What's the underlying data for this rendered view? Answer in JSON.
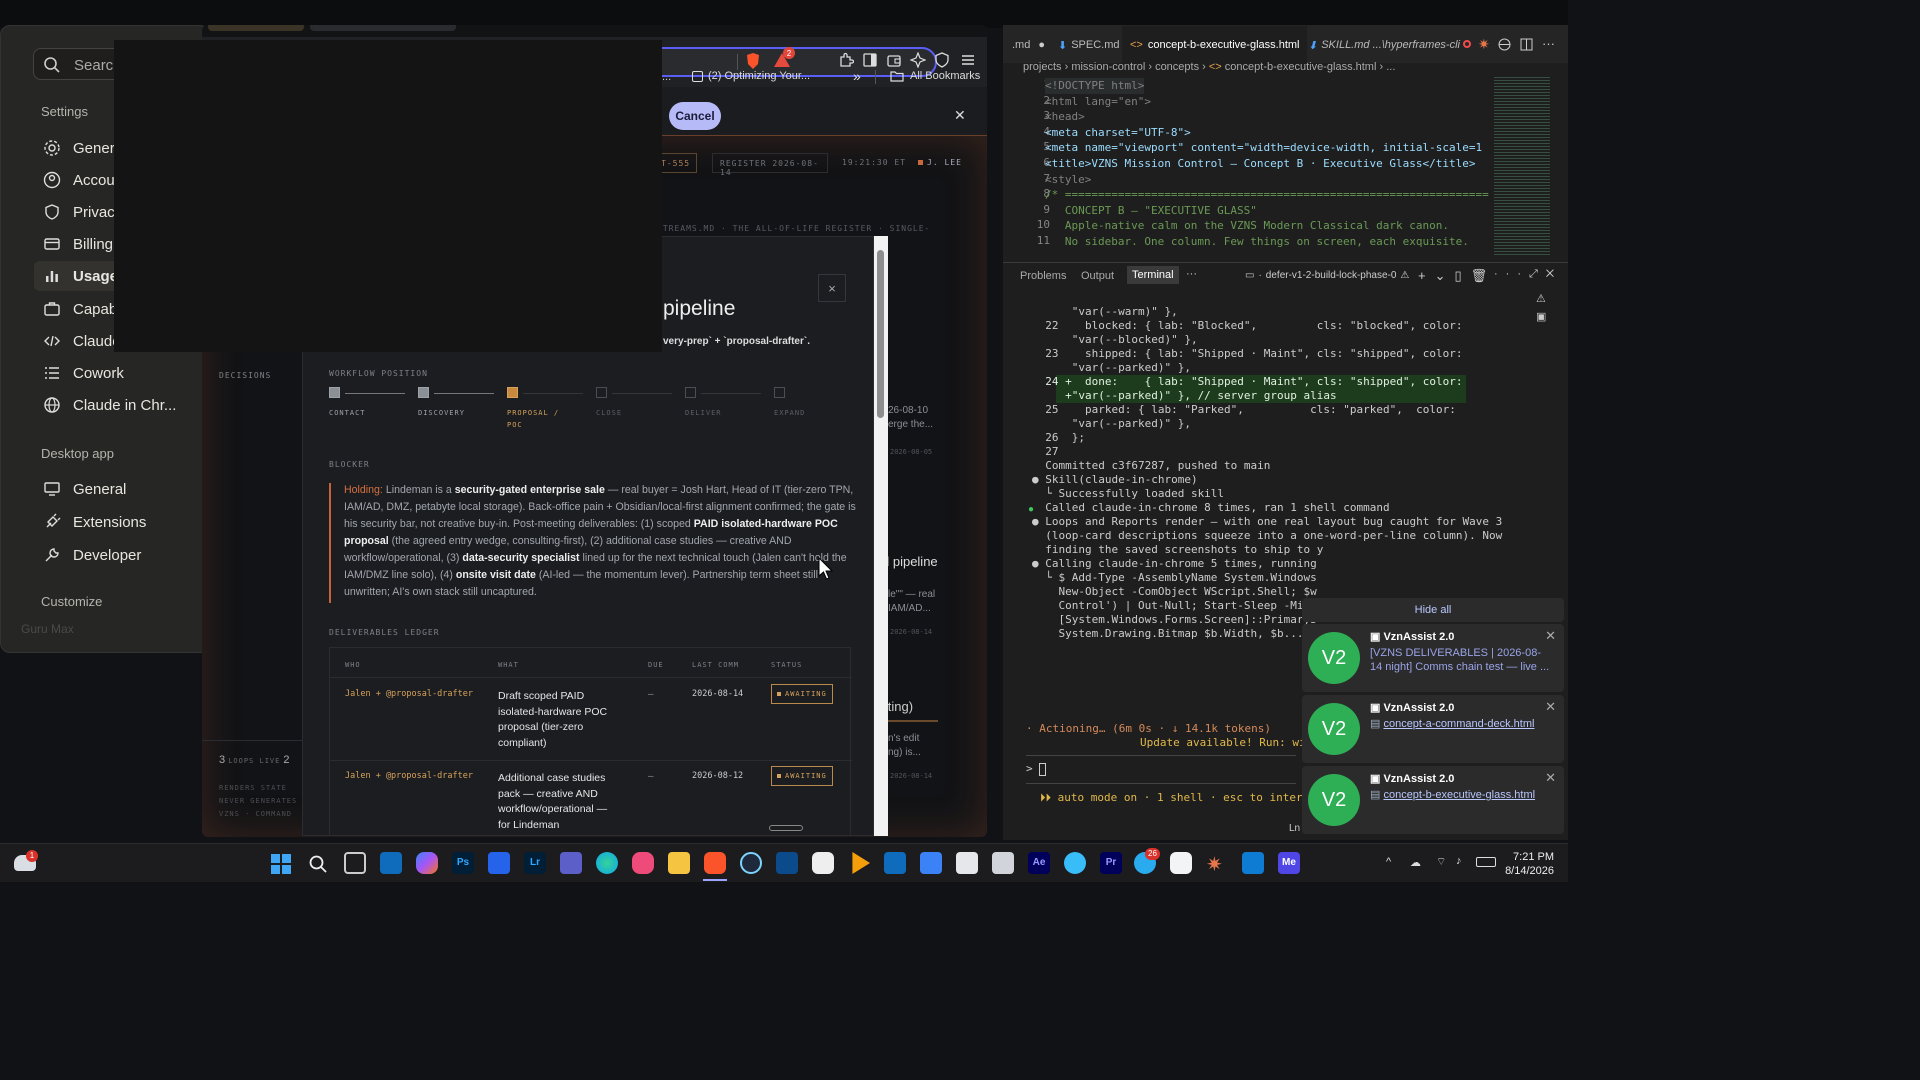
{
  "claude": {
    "search_placeholder": "Search",
    "settings_label": "Settings",
    "items": [
      "Genera",
      "Accou",
      "Privacy",
      "Billing",
      "Usage",
      "Capab",
      "Claude",
      "Cowork",
      "Claude in Chr..."
    ],
    "desktop_label": "Desktop app",
    "desktop_items": [
      "General",
      "Extensions",
      "Developer"
    ],
    "customize_label": "Customize"
  },
  "browser": {
    "bookmark": "(2) Optimizing Your...",
    "more": "»",
    "all_bookmarks": "All Bookmarks",
    "ellipsis": "...",
    "cancel": "Cancel",
    "close": "✕",
    "badge": "2"
  },
  "page": {
    "tag1": "T-555",
    "register": "REGISTER 2026-08-14",
    "time": "19:21:30 ET",
    "user": "J. LEE",
    "stream": "STREAMS.MD · THE ALL-OF-LIFE REGISTER · SINGLE-",
    "decisions": "DECISIONS",
    "side_date1": "26-08-10",
    "side_text1": "erge the...",
    "side_date2": "2026-08-05",
    "side_title": "d pipeline",
    "side_t2a": "le\"\" — real",
    "side_t2b": "IAM/AD...",
    "side_date3": "2026-08-14",
    "side_title2": "liting)",
    "side_t3a": "n's edit",
    "side_t3b": "ng) is...",
    "side_date4": "2026-08-14",
    "loops_num": "3",
    "loops_label": "LOOPS LIVE",
    "loops_num2": "2",
    "foot1": "RENDERS STATE",
    "foot2": "NEVER GENERATES",
    "foot3": "VZNS · COMMAND"
  },
  "modal": {
    "title": "pipeline",
    "subtitle": "very-prep` + `proposal-drafter`.",
    "close": "×",
    "workflow_label": "WORKFLOW POSITION",
    "steps": [
      "CONTACT",
      "DISCOVERY",
      "PROPOSAL / POC",
      "CLOSE",
      "DELIVER",
      "EXPAND"
    ],
    "blocker_label": "BLOCKER",
    "blocker_holding": "Holding:",
    "blocker_text1": " Lindeman is a ",
    "blocker_b1": "security-gated enterprise sale",
    "blocker_text2": " — real buyer = Josh Hart, Head of IT (tier-zero TPN, IAM/AD, DMZ, petabyte local storage). Back-office pain + Obsidian/local-first alignment confirmed; the gate is his security bar, not creative buy-in. Post-meeting deliverables: (1) scoped ",
    "blocker_b2": "PAID isolated-hardware POC proposal",
    "blocker_text3": " (the agreed entry wedge, consulting-first), (2) additional case studies — creative AND workflow/operational, (3) ",
    "blocker_b3": "data-security specialist",
    "blocker_text4": " lined up for the next technical touch (Jalen can't hold the IAM/DMZ line solo), (4) ",
    "blocker_b4": "onsite visit date",
    "blocker_text5": " (AI-led — the momentum lever). Partnership term sheet still unwritten; AI's own stack still uncaptured.",
    "ledger_label": "DELIVERABLES LEDGER",
    "columns": [
      "WHO",
      "WHAT",
      "DUE",
      "LAST COMM",
      "STATUS"
    ],
    "rows": [
      {
        "who": "Jalen + @proposal-drafter",
        "what": "Draft scoped PAID isolated-hardware POC proposal (tier-zero compliant)",
        "due": "–",
        "last": "2026-08-14",
        "status": "AWAITING"
      },
      {
        "who": "Jalen + @proposal-drafter",
        "what": "Additional case studies pack — creative AND workflow/operational — for Lindeman",
        "due": "–",
        "last": "2026-08-12",
        "status": "AWAITING"
      }
    ]
  },
  "vscode": {
    "tabs": [
      ".md",
      "SPEC.md",
      "concept-b-executive-glass.html",
      "SKILL.md ...\\hyperframes-cli"
    ],
    "breadcrumb": [
      "projects",
      "mission-control",
      "concepts",
      "concept-b-executive-glass.html",
      "..."
    ],
    "code_lines": [
      {
        "n": "1",
        "t": "<!DOCTYPE html>"
      },
      {
        "n": "2",
        "t": "<html lang=\"en\">"
      },
      {
        "n": "3",
        "t": "<head>"
      },
      {
        "n": "4",
        "t": "<meta charset=\"UTF-8\">"
      },
      {
        "n": "5",
        "t": "<meta name=\"viewport\" content=\"width=device-width, initial-scale=1"
      },
      {
        "n": "6",
        "t": "<title>VZNS Mission Control — Concept B · Executive Glass</title>"
      },
      {
        "n": "7",
        "t": "<style>"
      },
      {
        "n": "8",
        "t": "/* ================================================================"
      },
      {
        "n": "9",
        "t": "   CONCEPT B — \"EXECUTIVE GLASS\""
      },
      {
        "n": "10",
        "t": "   Apple-native calm on the VZNS Modern Classical dark canon."
      },
      {
        "n": "11",
        "t": "   No sidebar. One column. Few things on screen, each exquisite."
      }
    ],
    "panel_tabs": [
      "Problems",
      "Output",
      "Terminal",
      "···"
    ],
    "terminal_name": "defer-v1-2-build-lock-phase-0",
    "terminal": [
      "      \"var(--warm)\" },",
      "  22    blocked: { lab: \"Blocked\",         cls: \"blocked\", color:",
      "      \"var(--blocked)\" },",
      "  23    shipped: { lab: \"Shipped · Maint\", cls: \"shipped\", color:",
      "      \"var(--parked)\" },"
    ],
    "term_added": [
      "  24 +  done:    { lab: \"Shipped · Maint\", cls: \"shipped\", color:",
      "     +\"var(--parked)\" }, // server group alias"
    ],
    "terminal2": [
      "  25    parked: { lab: \"Parked\",          cls: \"parked\",  color:",
      "      \"var(--parked)\" },",
      "  26  };",
      "  27",
      "",
      "  Committed c3f67287, pushed to main",
      "",
      "● Skill(claude-in-chrome)",
      "  └ Successfully loaded skill",
      "",
      "  Called claude-in-chrome 8 times, ran 1 shell command",
      "",
      "● Loops and Reports render — with one real layout bug caught for Wave 3",
      "  (loop-card descriptions squeeze into a one-word-per-line column). Now",
      "  finding the saved screenshots to ship to y",
      "",
      "● Calling claude-in-chrome 5 times, running",
      "  └ $ Add-Type -AssemblyName System.Windows",
      "    New-Object -ComObject WScript.Shell; $w",
      "    Control') | Out-Null; Start-Sleep -Mill",
      "    [System.Windows.Forms.Screen]::PrimaryS",
      "    System.Drawing.Bitmap $b.Width, $b..."
    ],
    "actioning": "· Actioning… (6m 0s · ↓ 14.1k tokens)",
    "update": "Update available! Run: win",
    "prompt": "> ",
    "automode": "⏵⏵ auto mode on · 1 shell · esc to interru",
    "ln": "Ln"
  },
  "toasts": {
    "hide_all": "Hide all",
    "items": [
      {
        "title": "VznAssist 2.0",
        "body": "[VZNS DELIVERABLES | 2026-08-14 night] Comms chain test — live ..."
      },
      {
        "title": "VznAssist 2.0",
        "body": "concept-a-command-deck.html"
      },
      {
        "title": "VznAssist 2.0",
        "body": "concept-b-executive-glass.html"
      }
    ],
    "avatar": "V2"
  },
  "taskbar": {
    "time": "7:21 PM",
    "date": "8/14/2026",
    "weather_badge": "1",
    "telegram_badge": "26",
    "guru": "Guru",
    "guru_sub": "Max"
  }
}
